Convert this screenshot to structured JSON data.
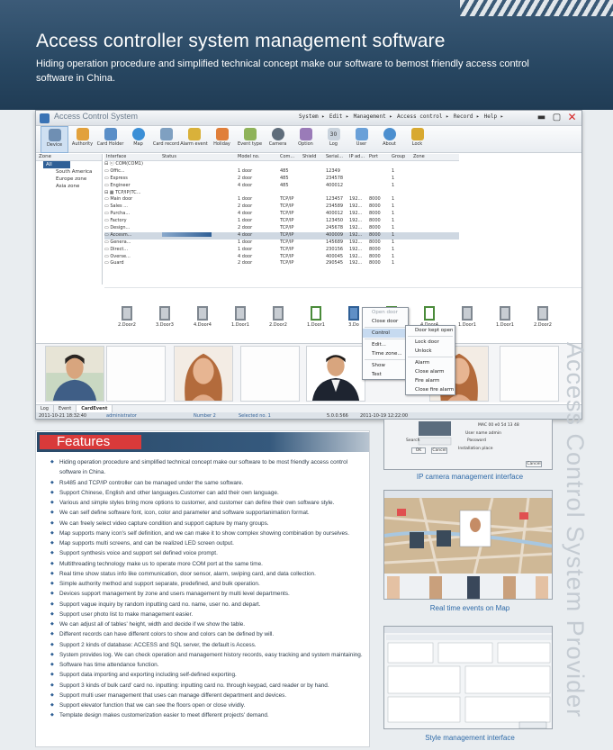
{
  "header": {
    "title": "Access controller system management software",
    "subtitle": "Hiding operation procedure and simplified technical concept make our software to bemost friendly access control software in China."
  },
  "app": {
    "title": "Access Control System",
    "menus": [
      "System ▸",
      "Edit ▸",
      "Management ▸",
      "Access control ▸",
      "Record ▸",
      "Help ▸"
    ],
    "window_buttons": [
      "▬",
      "▢",
      "✕"
    ],
    "toolbar": [
      {
        "label": "Device",
        "icon": "device-icon",
        "color": "#6f8fb3"
      },
      {
        "label": "Authority",
        "icon": "authority-icon",
        "color": "#e2a13c"
      },
      {
        "label": "Card Holder",
        "icon": "card-holder-icon",
        "color": "#5a8ec7"
      },
      {
        "label": "Map",
        "icon": "globe-icon",
        "color": "#3b8fd6"
      },
      {
        "label": "Card record",
        "icon": "card-record-icon",
        "color": "#7fa0c1"
      },
      {
        "label": "Alarm event",
        "icon": "alarm-icon",
        "color": "#d9b13a"
      },
      {
        "label": "Holiday",
        "icon": "holiday-icon",
        "color": "#e07f3a"
      },
      {
        "label": "Event type",
        "icon": "event-type-icon",
        "color": "#8fb35a"
      },
      {
        "label": "Camera",
        "icon": "camera-icon",
        "color": "#5f6d7b"
      },
      {
        "label": "Option",
        "icon": "option-icon",
        "color": "#9a7bb8"
      },
      {
        "label": "Log",
        "icon": "calendar-icon",
        "color": "#c9d3dd"
      },
      {
        "label": "User",
        "icon": "user-icon",
        "color": "#6aa0d8"
      },
      {
        "label": "About",
        "icon": "about-icon",
        "color": "#4c8fcf"
      },
      {
        "label": "Lock",
        "icon": "lock-icon",
        "color": "#d8a930"
      }
    ],
    "calendar_day": "30",
    "zone_panel": {
      "header": "Zone",
      "items": [
        {
          "label": "All",
          "selected": true,
          "level": 0
        },
        {
          "label": "South America",
          "selected": false,
          "level": 1
        },
        {
          "label": "Europe zone",
          "selected": false,
          "level": 1
        },
        {
          "label": "Asia zone",
          "selected": false,
          "level": 1
        }
      ]
    },
    "grid": {
      "columns": [
        "Interface",
        "Status",
        "Model no.",
        "Com...",
        "Shield",
        "Serial...",
        "IP ad...",
        "Port",
        "Group",
        "Zone"
      ],
      "rows": [
        {
          "interface": "⊟ ⓒ COM(COM1)",
          "status": "",
          "model": "",
          "com": "",
          "shield": "",
          "serial": "",
          "ip": "",
          "port": "",
          "group": "",
          "zone": ""
        },
        {
          "interface": "   ▭ Offic...",
          "status": "",
          "model": "1 door",
          "com": "485",
          "shield": "",
          "serial": "12349",
          "ip": "",
          "port": "",
          "group": "1",
          "zone": ""
        },
        {
          "interface": "   ▭ Express",
          "status": "",
          "model": "2 door",
          "com": "485",
          "shield": "",
          "serial": "234578",
          "ip": "",
          "port": "",
          "group": "1",
          "zone": ""
        },
        {
          "interface": "   ▭ Engineer",
          "status": "",
          "model": "4 door",
          "com": "485",
          "shield": "",
          "serial": "400012",
          "ip": "",
          "port": "",
          "group": "1",
          "zone": ""
        },
        {
          "interface": "⊟ ▦ TCP/IP(TC...",
          "status": "",
          "model": "",
          "com": "",
          "shield": "",
          "serial": "",
          "ip": "",
          "port": "",
          "group": "",
          "zone": ""
        },
        {
          "interface": "   ▭ Main door",
          "status": "",
          "model": "1 door",
          "com": "TCP/IP",
          "shield": "",
          "serial": "123457",
          "ip": "192...",
          "port": "8000",
          "group": "1",
          "zone": ""
        },
        {
          "interface": "   ▭ Sales ...",
          "status": "",
          "model": "2 door",
          "com": "TCP/IP",
          "shield": "",
          "serial": "234589",
          "ip": "192...",
          "port": "8000",
          "group": "1",
          "zone": ""
        },
        {
          "interface": "   ▭ Purcha...",
          "status": "",
          "model": "4 door",
          "com": "TCP/IP",
          "shield": "",
          "serial": "400012",
          "ip": "192...",
          "port": "8000",
          "group": "1",
          "zone": ""
        },
        {
          "interface": "   ▭ Factory",
          "status": "",
          "model": "1 door",
          "com": "TCP/IP",
          "shield": "",
          "serial": "123450",
          "ip": "192...",
          "port": "8000",
          "group": "1",
          "zone": ""
        },
        {
          "interface": "   ▭ Design...",
          "status": "",
          "model": "2 door",
          "com": "TCP/IP",
          "shield": "",
          "serial": "245678",
          "ip": "192...",
          "port": "8000",
          "group": "1",
          "zone": ""
        },
        {
          "interface": "   ▭ Accesm...",
          "status": "bar",
          "model": "4 door",
          "com": "TCP/IP",
          "shield": "",
          "serial": "400009",
          "ip": "192...",
          "port": "8000",
          "group": "1",
          "zone": "",
          "selected": true
        },
        {
          "interface": "   ▭ Genera...",
          "status": "",
          "model": "1 door",
          "com": "TCP/IP",
          "shield": "",
          "serial": "145689",
          "ip": "192...",
          "port": "8000",
          "group": "1",
          "zone": ""
        },
        {
          "interface": "   ▭ Direct...",
          "status": "",
          "model": "1 door",
          "com": "TCP/IP",
          "shield": "",
          "serial": "230156",
          "ip": "192...",
          "port": "8000",
          "group": "1",
          "zone": ""
        },
        {
          "interface": "   ▭ Overse...",
          "status": "",
          "model": "4 door",
          "com": "TCP/IP",
          "shield": "",
          "serial": "400045",
          "ip": "192...",
          "port": "8000",
          "group": "1",
          "zone": ""
        },
        {
          "interface": "   ▭ Guard",
          "status": "",
          "model": "2 door",
          "com": "TCP/IP",
          "shield": "",
          "serial": "290545",
          "ip": "192...",
          "port": "8000",
          "group": "1",
          "zone": ""
        }
      ]
    },
    "doors": [
      {
        "label": "2.Door2",
        "state": "closed"
      },
      {
        "label": "3.Door3",
        "state": "closed"
      },
      {
        "label": "4.Door4",
        "state": "closed"
      },
      {
        "label": "1.Door1",
        "state": "closed"
      },
      {
        "label": "2.Door2",
        "state": "closed"
      },
      {
        "label": "1.Door1",
        "state": "open"
      },
      {
        "label": "3.Do",
        "state": "selected"
      },
      {
        "label": "",
        "state": "open"
      },
      {
        "label": "4.Door4",
        "state": "open"
      },
      {
        "label": "1.Door1",
        "state": "closed"
      },
      {
        "label": "1.Door1",
        "state": "closed"
      },
      {
        "label": "2.Door2",
        "state": "closed"
      }
    ],
    "context_menu": [
      "Open door",
      "Close door",
      "Control",
      "Edit...",
      "Time zone...",
      "Show",
      "Test"
    ],
    "submenu": [
      "Door kept open",
      "Lock door",
      "Unlock",
      "Alarm",
      "Close alarm",
      "Fire alarm",
      "Close fire alarm"
    ],
    "bottom_tabs": [
      "Log",
      "Event",
      "CardEvent"
    ],
    "status_bar": {
      "datetime": "2011-10-21 18:32:40",
      "user": "administrator",
      "number": "Number 2",
      "selected": "Selected no. 1",
      "version": "5.0.0.566",
      "datetime2": "2011-10-19 12:22:00"
    }
  },
  "features": {
    "heading": "Features",
    "items": [
      "Hiding operation procedure and simplified technical concept make our software to be most friendly access control software in China.",
      "Rs485 and TCP/IP controller can be managed under the same software.",
      "Support Chinese, English and other languages.Customer can add their own language.",
      "Various and simple styles bring more options to customer, and customer can define their own software style.",
      "We can self define software font, icon, color and parameter and software supportanimation format.",
      "We can freely select video capture condition and support capture by many groups.",
      "Map supports many icon's self definition, and we can make it to show complex showing combination by ourselves.",
      "Map supports multi screens, and can be realized LED screen output.",
      "Support synthesis voice and support sel defined voice prompt.",
      "Multithreading technology make us to operate more COM port at the same time.",
      "Real time show status info like communication, door sensor, alarm, swiping card, and data collection.",
      "Simple authority method and support separate, predefined, and bulk operation.",
      "Devices support management by zone and users management by multi level departments.",
      "Support vague inquiry by random inputting card no. name, user no. and depart.",
      "Support user photo list to make management easier.",
      "We can adjust all of tables' height, width and decide if we show the table.",
      "Different records can have different colors to show and colors can be defined by will.",
      "Support 2 kinds of database: ACCESS and SQL server, the default is Access.",
      "System provides log. We can check operation and management history records, easy tracking and system maintaining.",
      "Software has time attendance function.",
      "Support data importing and exporting including self-defined exporting.",
      "Support 3 kinds of bulk card' card no. inputting: inputting card no. through keypad, card reader or by hand.",
      "Support multi user management that uses can manage different department and devices.",
      "Support elevator function that we can see the floors open or close vividly.",
      "Template design makes customerization easier to meet different projects' demand."
    ]
  },
  "right_column": {
    "ip_camera": {
      "caption": "IP camera management interface",
      "mac_label": "MAC  00 e0 5d 13 48",
      "user_label": "User name  admin",
      "password_label": "Password",
      "search_button": "Search",
      "installation_label": "Installation place",
      "ok": "OK",
      "cancel": "Cancel"
    },
    "map": {
      "caption": "Real time events on Map"
    },
    "style": {
      "caption": "Style management interface"
    }
  },
  "vertical_brand": "Access Control System Provider"
}
